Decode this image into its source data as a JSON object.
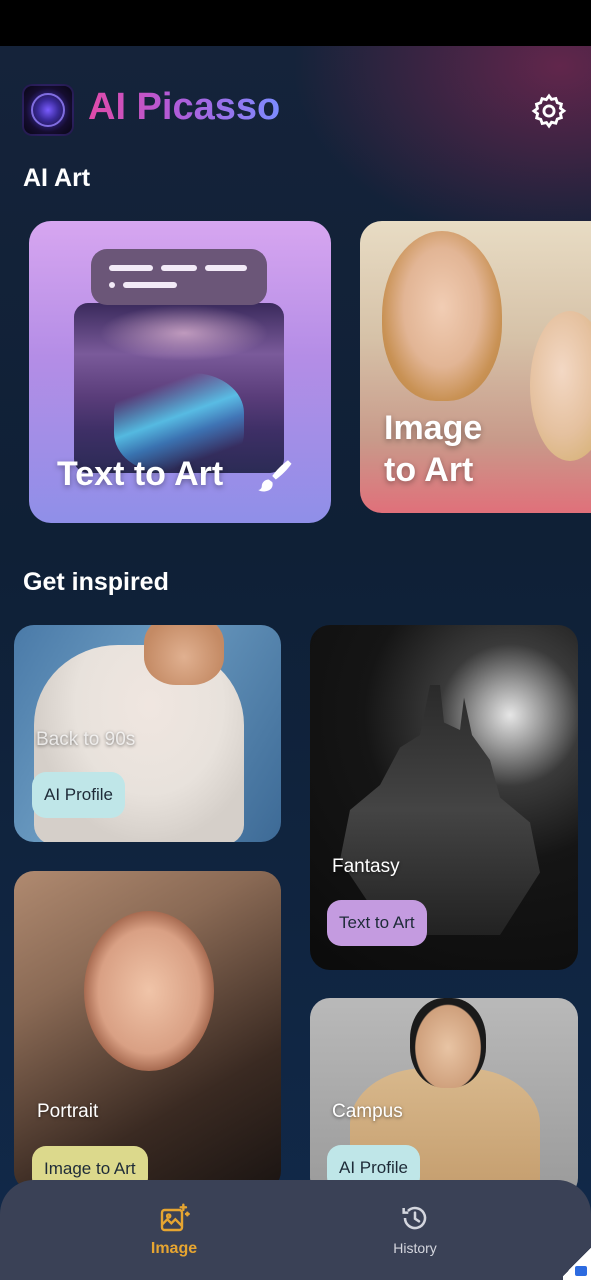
{
  "app": {
    "title": "AI Picasso"
  },
  "sections": {
    "ai_art": "AI Art",
    "get_inspired": "Get inspired"
  },
  "features": [
    {
      "label": "Text to Art"
    },
    {
      "label_line1": "Image",
      "label_line2": "to Art"
    }
  ],
  "inspire": [
    {
      "name": "Back to 90s",
      "tag": "AI Profile"
    },
    {
      "name": "Fantasy",
      "tag": "Text to Art"
    },
    {
      "name": "Portrait",
      "tag": "Image to Art"
    },
    {
      "name": "Campus",
      "tag": "AI Profile"
    }
  ],
  "nav": [
    {
      "label": "Image",
      "icon": "image-sparkle-icon",
      "active": true
    },
    {
      "label": "History",
      "icon": "history-icon",
      "active": false
    }
  ],
  "colors": {
    "accent": "#e6a531",
    "title_gradient_start": "#e04aa8",
    "title_gradient_end": "#7c8cff"
  }
}
